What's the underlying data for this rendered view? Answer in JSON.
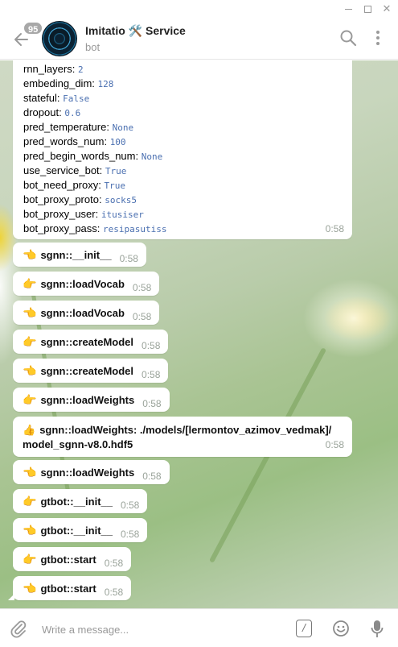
{
  "window": {
    "minimize": "",
    "maximize": "",
    "close": "✕"
  },
  "header": {
    "badge": "95",
    "title": "Imitatio 🛠️ Service",
    "subtitle": "bot"
  },
  "config_message": {
    "rows": [
      {
        "key": "rnn_layers:",
        "value": "2"
      },
      {
        "key": "embeding_dim:",
        "value": "128"
      },
      {
        "key": "stateful:",
        "value": "False"
      },
      {
        "key": "dropout:",
        "value": "0.6"
      },
      {
        "key": "pred_temperature:",
        "value": "None"
      },
      {
        "key": "pred_words_num:",
        "value": "100"
      },
      {
        "key": "pred_begin_words_num:",
        "value": "None"
      },
      {
        "key": "use_service_bot:",
        "value": "True"
      },
      {
        "key": "bot_need_proxy:",
        "value": "True"
      },
      {
        "key": "bot_proxy_proto:",
        "value": "socks5"
      },
      {
        "key": "bot_proxy_user:",
        "value": "itusiser"
      },
      {
        "key": "bot_proxy_pass:",
        "value": "resipasutiss"
      }
    ],
    "time": "0:58"
  },
  "messages": [
    {
      "emoji": "👈",
      "text": "sgnn::__init__",
      "time": "0:58"
    },
    {
      "emoji": "👉",
      "text": "sgnn::loadVocab",
      "time": "0:58"
    },
    {
      "emoji": "👈",
      "text": "sgnn::loadVocab",
      "time": "0:58"
    },
    {
      "emoji": "👉",
      "text": "sgnn::createModel",
      "time": "0:58"
    },
    {
      "emoji": "👈",
      "text": "sgnn::createModel",
      "time": "0:58"
    },
    {
      "emoji": "👉",
      "text": "sgnn::loadWeights",
      "time": "0:58"
    },
    {
      "emoji": "👍",
      "text": "sgnn::loadWeights: ./models/[lermontov_azimov_vedmak]/",
      "text2": "model_sgnn-v8.0.hdf5",
      "time": "0:58"
    },
    {
      "emoji": "👈",
      "text": "sgnn::loadWeights",
      "time": "0:58"
    },
    {
      "emoji": "👉",
      "text": "gtbot::__init__",
      "time": "0:58"
    },
    {
      "emoji": "👈",
      "text": "gtbot::__init__",
      "time": "0:58"
    },
    {
      "emoji": "👉",
      "text": "gtbot::start",
      "time": "0:58"
    },
    {
      "emoji": "👈",
      "text": "gtbot::start",
      "time": "0:58"
    }
  ],
  "composer": {
    "placeholder": "Write a message...",
    "command_glyph": "/"
  }
}
